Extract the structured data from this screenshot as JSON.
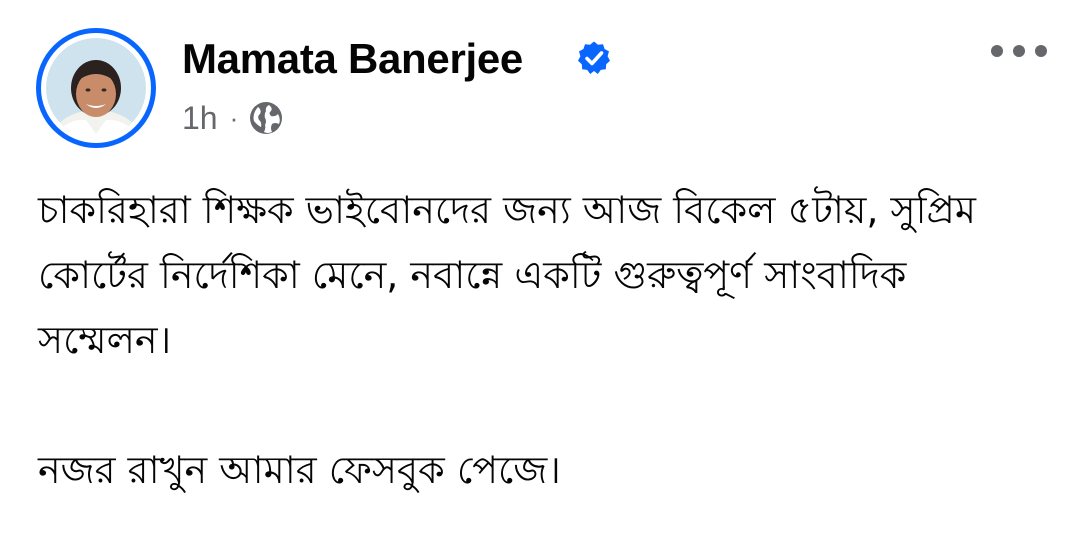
{
  "post": {
    "author": "Mamata Banerjee",
    "verified": true,
    "timestamp": "1h",
    "separator": "·",
    "audience_icon": "globe-icon",
    "more_icon": "more-options-icon",
    "paragraphs": [
      "চাকরিহারা শিক্ষক ভাইবোনদের জন্য আজ বিকেল ৫টায়, সুপ্রিম কোর্টের নির্দেশিকা মেনে, নবান্নে একটি গুরুত্বপূর্ণ সাংবাদিক সম্মেলন।",
      "নজর রাখুন আমার ফেসবুক পেজে।"
    ]
  },
  "colors": {
    "accent": "#0866ff",
    "text": "#050505",
    "secondary_text": "#65676b"
  }
}
